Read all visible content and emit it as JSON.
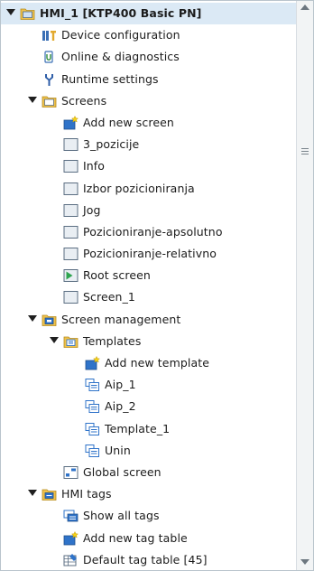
{
  "tree": {
    "items": [
      {
        "label": "HMI_1 [KTP400 Basic PN]",
        "level": 0,
        "arrow": true,
        "icon": "hmi-device-folder-icon",
        "bold": true,
        "selected": true
      },
      {
        "label": "Device configuration",
        "level": 1,
        "arrow": false,
        "icon": "device-configuration-icon"
      },
      {
        "label": "Online & diagnostics",
        "level": 1,
        "arrow": false,
        "icon": "online-diagnostics-icon"
      },
      {
        "label": "Runtime settings",
        "level": 1,
        "arrow": false,
        "icon": "runtime-settings-icon"
      },
      {
        "label": "Screens",
        "level": 1,
        "arrow": true,
        "icon": "screens-folder-icon"
      },
      {
        "label": "Add new screen",
        "level": 2,
        "arrow": false,
        "icon": "add-new-screen-icon"
      },
      {
        "label": "3_pozicije",
        "level": 2,
        "arrow": false,
        "icon": "screen-icon"
      },
      {
        "label": "Info",
        "level": 2,
        "arrow": false,
        "icon": "screen-icon"
      },
      {
        "label": "Izbor pozicioniranja",
        "level": 2,
        "arrow": false,
        "icon": "screen-icon"
      },
      {
        "label": "Jog",
        "level": 2,
        "arrow": false,
        "icon": "screen-icon"
      },
      {
        "label": "Pozicioniranje-apsolutno",
        "level": 2,
        "arrow": false,
        "icon": "screen-icon"
      },
      {
        "label": "Pozicioniranje-relativno",
        "level": 2,
        "arrow": false,
        "icon": "screen-icon"
      },
      {
        "label": "Root screen",
        "level": 2,
        "arrow": false,
        "icon": "root-screen-icon"
      },
      {
        "label": "Screen_1",
        "level": 2,
        "arrow": false,
        "icon": "screen-icon"
      },
      {
        "label": "Screen management",
        "level": 1,
        "arrow": true,
        "icon": "screen-management-folder-icon"
      },
      {
        "label": "Templates",
        "level": 2,
        "arrow": true,
        "icon": "templates-folder-icon"
      },
      {
        "label": "Add new template",
        "level": 3,
        "arrow": false,
        "icon": "add-new-template-icon"
      },
      {
        "label": "Aip_1",
        "level": 3,
        "arrow": false,
        "icon": "template-icon"
      },
      {
        "label": "Aip_2",
        "level": 3,
        "arrow": false,
        "icon": "template-icon"
      },
      {
        "label": "Template_1",
        "level": 3,
        "arrow": false,
        "icon": "template-icon"
      },
      {
        "label": "Unin",
        "level": 3,
        "arrow": false,
        "icon": "template-icon"
      },
      {
        "label": "Global screen",
        "level": 2,
        "arrow": false,
        "icon": "global-screen-icon"
      },
      {
        "label": "HMI tags",
        "level": 1,
        "arrow": true,
        "icon": "hmi-tags-folder-icon"
      },
      {
        "label": "Show all tags",
        "level": 2,
        "arrow": false,
        "icon": "show-all-tags-icon"
      },
      {
        "label": "Add new tag table",
        "level": 2,
        "arrow": false,
        "icon": "add-new-tag-table-icon"
      },
      {
        "label": "Default tag table [45]",
        "level": 2,
        "arrow": false,
        "icon": "tag-table-icon"
      }
    ]
  },
  "colors": {
    "selection": "#dbe9f5",
    "folder": "#f0c24b",
    "screen_fill": "#e9eef3",
    "screen_border": "#5b6e82",
    "root_green": "#2ea44f",
    "template_blue": "#2f73c9"
  }
}
